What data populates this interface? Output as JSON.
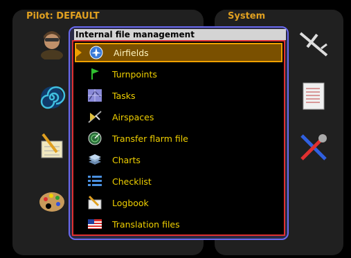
{
  "left_panel": {
    "title": "Pilot: DEFAULT"
  },
  "right_panel": {
    "title": "System"
  },
  "dialog": {
    "title": "Internal file management",
    "items": [
      {
        "label": "Airfields",
        "icon": "airplane-icon",
        "selected": true
      },
      {
        "label": "Turnpoints",
        "icon": "flag-icon"
      },
      {
        "label": "Tasks",
        "icon": "task-icon"
      },
      {
        "label": "Airspaces",
        "icon": "airspace-icon"
      },
      {
        "label": "Transfer flarm file",
        "icon": "flarm-radar-icon"
      },
      {
        "label": "Charts",
        "icon": "layers-icon"
      },
      {
        "label": "Checklist",
        "icon": "list-icon"
      },
      {
        "label": "Logbook",
        "icon": "logbook-icon"
      },
      {
        "label": "Translation files",
        "icon": "flag-usa-icon"
      }
    ]
  },
  "colors": {
    "accent": "#e0a020",
    "item_text": "#f0d000",
    "selection_bg": "#7a5000",
    "dialog_border": "#6a6af0",
    "list_border": "#e03030"
  }
}
